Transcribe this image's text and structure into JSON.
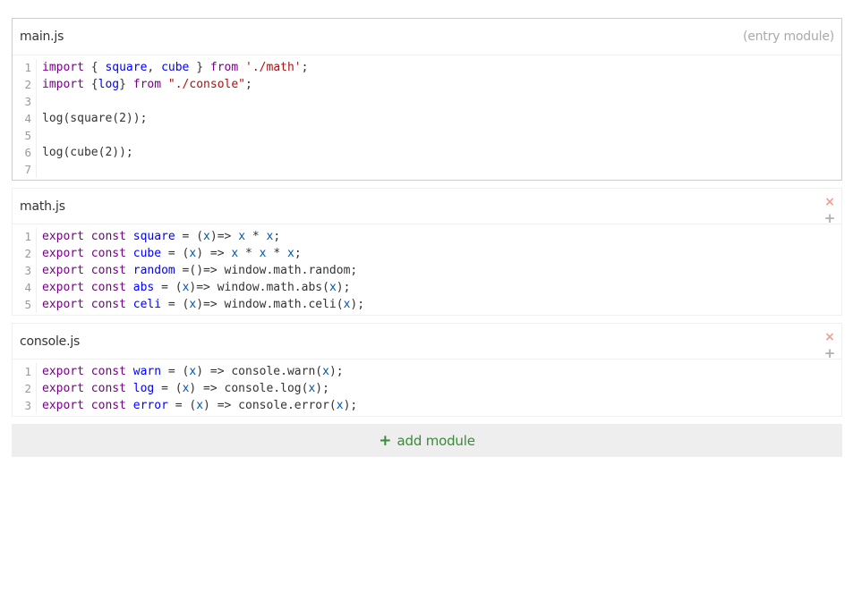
{
  "modules": [
    {
      "name": "main.js",
      "note": "(entry module)",
      "lines": [
        {
          "n": "1",
          "tokens": [
            [
              "kw",
              "import"
            ],
            [
              "pl",
              " { "
            ],
            [
              "df",
              "square"
            ],
            [
              "pl",
              ", "
            ],
            [
              "df",
              "cube"
            ],
            [
              "pl",
              " } "
            ],
            [
              "kw",
              "from"
            ],
            [
              "pl",
              " "
            ],
            [
              "st",
              "'./math'"
            ],
            [
              "pl",
              ";"
            ]
          ]
        },
        {
          "n": "2",
          "tokens": [
            [
              "kw",
              "import"
            ],
            [
              "pl",
              " {"
            ],
            [
              "df",
              "log"
            ],
            [
              "pl",
              "} "
            ],
            [
              "kw",
              "from"
            ],
            [
              "pl",
              " "
            ],
            [
              "st",
              "\"./console\""
            ],
            [
              "pl",
              ";"
            ]
          ]
        },
        {
          "n": "3",
          "tokens": []
        },
        {
          "n": "4",
          "tokens": [
            [
              "pl",
              "log(square(2));"
            ]
          ]
        },
        {
          "n": "5",
          "tokens": []
        },
        {
          "n": "6",
          "tokens": [
            [
              "pl",
              "log(cube(2));"
            ]
          ]
        },
        {
          "n": "7",
          "tokens": []
        }
      ]
    },
    {
      "name": "math.js",
      "remove_label": "×",
      "add_label": "+",
      "lines": [
        {
          "n": "1",
          "tokens": [
            [
              "kw",
              "export"
            ],
            [
              "pl",
              " "
            ],
            [
              "kw",
              "const"
            ],
            [
              "pl",
              " "
            ],
            [
              "df",
              "square"
            ],
            [
              "pl",
              " = ("
            ],
            [
              "vr",
              "x"
            ],
            [
              "pl",
              ")=> "
            ],
            [
              "vr",
              "x"
            ],
            [
              "pl",
              " * "
            ],
            [
              "vr",
              "x"
            ],
            [
              "pl",
              ";"
            ]
          ]
        },
        {
          "n": "2",
          "tokens": [
            [
              "kw",
              "export"
            ],
            [
              "pl",
              " "
            ],
            [
              "kw",
              "const"
            ],
            [
              "pl",
              " "
            ],
            [
              "df",
              "cube"
            ],
            [
              "pl",
              " = ("
            ],
            [
              "vr",
              "x"
            ],
            [
              "pl",
              ") => "
            ],
            [
              "vr",
              "x"
            ],
            [
              "pl",
              " * "
            ],
            [
              "vr",
              "x"
            ],
            [
              "pl",
              " * "
            ],
            [
              "vr",
              "x"
            ],
            [
              "pl",
              ";"
            ]
          ]
        },
        {
          "n": "3",
          "tokens": [
            [
              "kw",
              "export"
            ],
            [
              "pl",
              " "
            ],
            [
              "kw",
              "const"
            ],
            [
              "pl",
              " "
            ],
            [
              "df",
              "random"
            ],
            [
              "pl",
              " =()=> window.math.random;"
            ]
          ]
        },
        {
          "n": "4",
          "tokens": [
            [
              "kw",
              "export"
            ],
            [
              "pl",
              " "
            ],
            [
              "kw",
              "const"
            ],
            [
              "pl",
              " "
            ],
            [
              "df",
              "abs"
            ],
            [
              "pl",
              " = ("
            ],
            [
              "vr",
              "x"
            ],
            [
              "pl",
              ")=> window.math.abs("
            ],
            [
              "vr",
              "x"
            ],
            [
              "pl",
              ");"
            ]
          ]
        },
        {
          "n": "5",
          "tokens": [
            [
              "kw",
              "export"
            ],
            [
              "pl",
              " "
            ],
            [
              "kw",
              "const"
            ],
            [
              "pl",
              " "
            ],
            [
              "df",
              "celi"
            ],
            [
              "pl",
              " = ("
            ],
            [
              "vr",
              "x"
            ],
            [
              "pl",
              ")=> window.math.celi("
            ],
            [
              "vr",
              "x"
            ],
            [
              "pl",
              ");"
            ]
          ]
        }
      ]
    },
    {
      "name": "console.js",
      "remove_label": "×",
      "add_label": "+",
      "lines": [
        {
          "n": "1",
          "tokens": [
            [
              "kw",
              "export"
            ],
            [
              "pl",
              " "
            ],
            [
              "kw",
              "const"
            ],
            [
              "pl",
              " "
            ],
            [
              "df",
              "warn"
            ],
            [
              "pl",
              " = ("
            ],
            [
              "vr",
              "x"
            ],
            [
              "pl",
              ") => console.warn("
            ],
            [
              "vr",
              "x"
            ],
            [
              "pl",
              ");"
            ]
          ]
        },
        {
          "n": "2",
          "tokens": [
            [
              "kw",
              "export"
            ],
            [
              "pl",
              " "
            ],
            [
              "kw",
              "const"
            ],
            [
              "pl",
              " "
            ],
            [
              "df",
              "log"
            ],
            [
              "pl",
              " = ("
            ],
            [
              "vr",
              "x"
            ],
            [
              "pl",
              ") => console.log("
            ],
            [
              "vr",
              "x"
            ],
            [
              "pl",
              ");"
            ]
          ]
        },
        {
          "n": "3",
          "tokens": [
            [
              "kw",
              "export"
            ],
            [
              "pl",
              " "
            ],
            [
              "kw",
              "const"
            ],
            [
              "pl",
              " "
            ],
            [
              "df",
              "error"
            ],
            [
              "pl",
              " = ("
            ],
            [
              "vr",
              "x"
            ],
            [
              "pl",
              ") => console.error("
            ],
            [
              "vr",
              "x"
            ],
            [
              "pl",
              ");"
            ]
          ]
        }
      ]
    }
  ],
  "add_module": {
    "icon": "plus-icon",
    "plus": "+",
    "label": "add module"
  },
  "colors": {
    "keyword": "#770088",
    "definition": "#0000ff",
    "variable": "#0055aa",
    "string": "#aa1111",
    "accent_green": "#3a8a3a",
    "remove_red": "#f0a090"
  }
}
